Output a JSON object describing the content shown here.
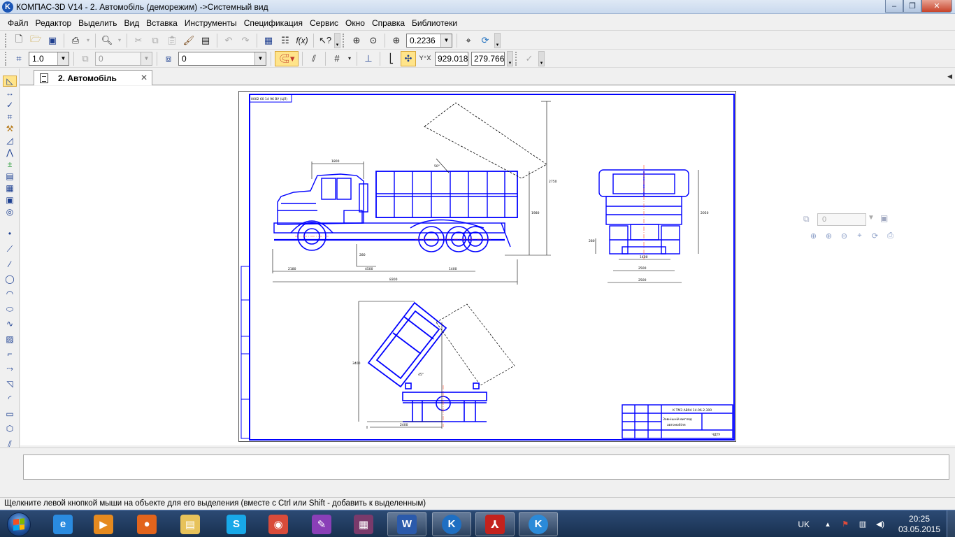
{
  "window": {
    "title": "КОМПАС-3D V14 - 2. Автомобіль (деморежим) ->Системный вид",
    "app_icon_label": "K",
    "minimize": "‒",
    "maximize": "❐",
    "close": "✕"
  },
  "menu": [
    "Файл",
    "Редактор",
    "Выделить",
    "Вид",
    "Вставка",
    "Инструменты",
    "Спецификация",
    "Сервис",
    "Окно",
    "Справка",
    "Библиотеки"
  ],
  "toolbar1": {
    "zoom_value": "0.2236"
  },
  "toolbar2": {
    "line_scale": "1.0",
    "layer_disabled": "0",
    "style_value": "0",
    "coord_x": "929.018",
    "coord_y": "279.766"
  },
  "document_tab": {
    "label": "2. Автомобіль",
    "close": "✕"
  },
  "float_panel": {
    "combo_value": "0"
  },
  "drawing": {
    "stamp_line1": "К ТМЗ  АВ94 14.06.2.300",
    "stamp_line2": "Зовнішній вигляд",
    "stamp_line3": "автомобіля",
    "stamp_org": "ЧДТУ",
    "corner_code": "0002 60 14 96 ВУ (ЦЛ)",
    "dims": {
      "d1": "1800",
      "d2": "2180",
      "d3": "1980",
      "d4": "2150",
      "d5": "4500",
      "d6": "1400",
      "d7": "8300",
      "d8": "2750",
      "d9": "1400",
      "d10": "2500",
      "d11": "2500",
      "d12": "2050",
      "d13": "280",
      "d14": "2400",
      "d15": "3400",
      "a1": "50°",
      "a2": "45°"
    }
  },
  "status_text": "Щелкните левой кнопкой мыши на объекте для его выделения (вместе с Ctrl или Shift - добавить к выделенным)",
  "taskbar": {
    "lang": "UK",
    "time": "20:25",
    "date": "03.05.2015",
    "apps": [
      {
        "name": "internet-explorer",
        "glyph": "e",
        "color": "#2a8be0"
      },
      {
        "name": "media-player",
        "glyph": "▶",
        "color": "#e58a1f"
      },
      {
        "name": "firefox",
        "glyph": "●",
        "color": "#e2641c"
      },
      {
        "name": "file-explorer",
        "glyph": "▤",
        "color": "#e7c25a"
      },
      {
        "name": "skype",
        "glyph": "S",
        "color": "#18a8e8"
      },
      {
        "name": "chrome",
        "glyph": "◉",
        "color": "#d94b3a"
      },
      {
        "name": "onenote",
        "glyph": "✎",
        "color": "#8a3fb7"
      },
      {
        "name": "winrar",
        "glyph": "▦",
        "color": "#7a3a6b"
      },
      {
        "name": "word",
        "glyph": "W",
        "color": "#2b5aab"
      },
      {
        "name": "kompas-1",
        "glyph": "K",
        "color": "#1f6fc2"
      },
      {
        "name": "acrobat",
        "glyph": "⅄",
        "color": "#c3221d"
      },
      {
        "name": "kompas-2",
        "glyph": "K",
        "color": "#2b8ad8"
      }
    ]
  },
  "colors": {
    "drawing_blue": "#0000ff",
    "taskbar_top": "#2c4a74"
  }
}
